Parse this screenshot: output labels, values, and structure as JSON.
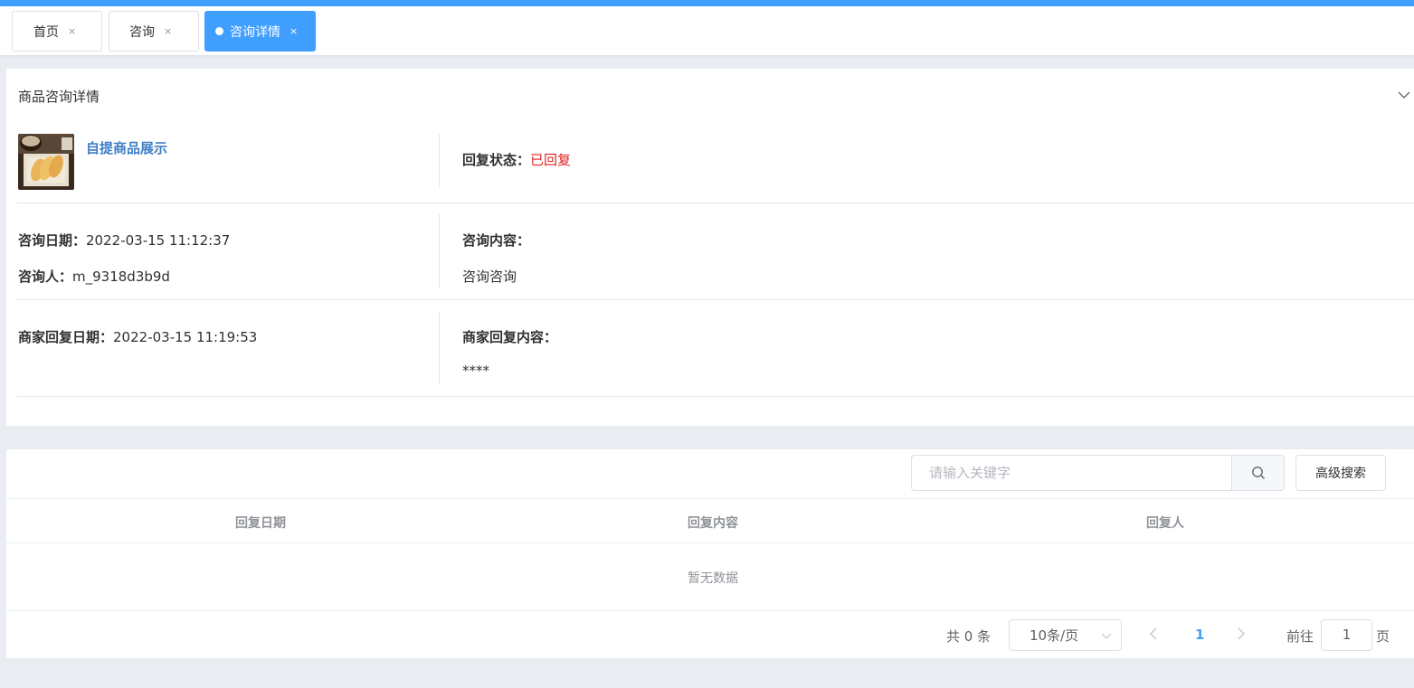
{
  "tabs": [
    {
      "label": "首页",
      "close": "×"
    },
    {
      "label": "咨询",
      "close": "×"
    },
    {
      "label": "咨询详情",
      "close": "×",
      "active": true
    }
  ],
  "detail": {
    "title": "商品咨询详情",
    "goods_name": "自提商品展示",
    "reply_status_label": "回复状态：",
    "reply_status_value": "已回复",
    "consult_date_label": "咨询日期：",
    "consult_date_value": "2022-03-15 11:12:37",
    "consultant_label": "咨询人：",
    "consultant_value": "m_9318d3b9d",
    "consult_content_label": "咨询内容：",
    "consult_content_value": "咨询咨询",
    "merchant_reply_date_label": "商家回复日期：",
    "merchant_reply_date_value": "2022-03-15 11:19:53",
    "merchant_reply_content_label": "商家回复内容：",
    "merchant_reply_content_value": "****"
  },
  "search": {
    "placeholder": "请输入关键字",
    "advanced_label": "高级搜索"
  },
  "table": {
    "columns": [
      "回复日期",
      "回复内容",
      "回复人"
    ],
    "empty_text": "暂无数据"
  },
  "pagination": {
    "total": "共 0 条",
    "page_size": "10条/页",
    "current_page": "1",
    "goto_label": "前往",
    "goto_value": "1",
    "page_suffix": "页"
  },
  "colors": {
    "accent": "#409eff",
    "status_red": "#e02020",
    "link_blue": "#3f7ec5"
  }
}
